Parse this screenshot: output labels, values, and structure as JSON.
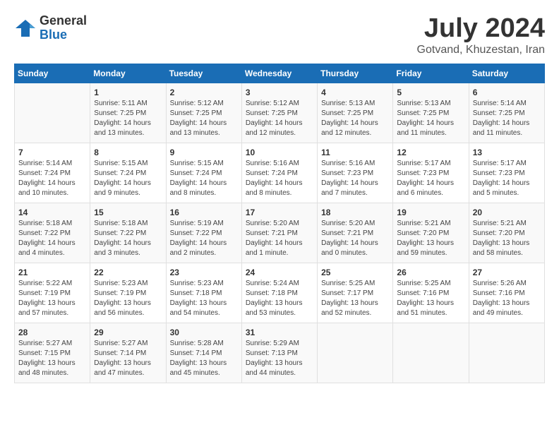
{
  "logo": {
    "text_general": "General",
    "text_blue": "Blue"
  },
  "title": "July 2024",
  "subtitle": "Gotvand, Khuzestan, Iran",
  "days_of_week": [
    "Sunday",
    "Monday",
    "Tuesday",
    "Wednesday",
    "Thursday",
    "Friday",
    "Saturday"
  ],
  "weeks": [
    [
      {
        "day": "",
        "info": ""
      },
      {
        "day": "1",
        "info": "Sunrise: 5:11 AM\nSunset: 7:25 PM\nDaylight: 14 hours\nand 13 minutes."
      },
      {
        "day": "2",
        "info": "Sunrise: 5:12 AM\nSunset: 7:25 PM\nDaylight: 14 hours\nand 13 minutes."
      },
      {
        "day": "3",
        "info": "Sunrise: 5:12 AM\nSunset: 7:25 PM\nDaylight: 14 hours\nand 12 minutes."
      },
      {
        "day": "4",
        "info": "Sunrise: 5:13 AM\nSunset: 7:25 PM\nDaylight: 14 hours\nand 12 minutes."
      },
      {
        "day": "5",
        "info": "Sunrise: 5:13 AM\nSunset: 7:25 PM\nDaylight: 14 hours\nand 11 minutes."
      },
      {
        "day": "6",
        "info": "Sunrise: 5:14 AM\nSunset: 7:25 PM\nDaylight: 14 hours\nand 11 minutes."
      }
    ],
    [
      {
        "day": "7",
        "info": "Sunrise: 5:14 AM\nSunset: 7:24 PM\nDaylight: 14 hours\nand 10 minutes."
      },
      {
        "day": "8",
        "info": "Sunrise: 5:15 AM\nSunset: 7:24 PM\nDaylight: 14 hours\nand 9 minutes."
      },
      {
        "day": "9",
        "info": "Sunrise: 5:15 AM\nSunset: 7:24 PM\nDaylight: 14 hours\nand 8 minutes."
      },
      {
        "day": "10",
        "info": "Sunrise: 5:16 AM\nSunset: 7:24 PM\nDaylight: 14 hours\nand 8 minutes."
      },
      {
        "day": "11",
        "info": "Sunrise: 5:16 AM\nSunset: 7:23 PM\nDaylight: 14 hours\nand 7 minutes."
      },
      {
        "day": "12",
        "info": "Sunrise: 5:17 AM\nSunset: 7:23 PM\nDaylight: 14 hours\nand 6 minutes."
      },
      {
        "day": "13",
        "info": "Sunrise: 5:17 AM\nSunset: 7:23 PM\nDaylight: 14 hours\nand 5 minutes."
      }
    ],
    [
      {
        "day": "14",
        "info": "Sunrise: 5:18 AM\nSunset: 7:22 PM\nDaylight: 14 hours\nand 4 minutes."
      },
      {
        "day": "15",
        "info": "Sunrise: 5:18 AM\nSunset: 7:22 PM\nDaylight: 14 hours\nand 3 minutes."
      },
      {
        "day": "16",
        "info": "Sunrise: 5:19 AM\nSunset: 7:22 PM\nDaylight: 14 hours\nand 2 minutes."
      },
      {
        "day": "17",
        "info": "Sunrise: 5:20 AM\nSunset: 7:21 PM\nDaylight: 14 hours\nand 1 minute."
      },
      {
        "day": "18",
        "info": "Sunrise: 5:20 AM\nSunset: 7:21 PM\nDaylight: 14 hours\nand 0 minutes."
      },
      {
        "day": "19",
        "info": "Sunrise: 5:21 AM\nSunset: 7:20 PM\nDaylight: 13 hours\nand 59 minutes."
      },
      {
        "day": "20",
        "info": "Sunrise: 5:21 AM\nSunset: 7:20 PM\nDaylight: 13 hours\nand 58 minutes."
      }
    ],
    [
      {
        "day": "21",
        "info": "Sunrise: 5:22 AM\nSunset: 7:19 PM\nDaylight: 13 hours\nand 57 minutes."
      },
      {
        "day": "22",
        "info": "Sunrise: 5:23 AM\nSunset: 7:19 PM\nDaylight: 13 hours\nand 56 minutes."
      },
      {
        "day": "23",
        "info": "Sunrise: 5:23 AM\nSunset: 7:18 PM\nDaylight: 13 hours\nand 54 minutes."
      },
      {
        "day": "24",
        "info": "Sunrise: 5:24 AM\nSunset: 7:18 PM\nDaylight: 13 hours\nand 53 minutes."
      },
      {
        "day": "25",
        "info": "Sunrise: 5:25 AM\nSunset: 7:17 PM\nDaylight: 13 hours\nand 52 minutes."
      },
      {
        "day": "26",
        "info": "Sunrise: 5:25 AM\nSunset: 7:16 PM\nDaylight: 13 hours\nand 51 minutes."
      },
      {
        "day": "27",
        "info": "Sunrise: 5:26 AM\nSunset: 7:16 PM\nDaylight: 13 hours\nand 49 minutes."
      }
    ],
    [
      {
        "day": "28",
        "info": "Sunrise: 5:27 AM\nSunset: 7:15 PM\nDaylight: 13 hours\nand 48 minutes."
      },
      {
        "day": "29",
        "info": "Sunrise: 5:27 AM\nSunset: 7:14 PM\nDaylight: 13 hours\nand 47 minutes."
      },
      {
        "day": "30",
        "info": "Sunrise: 5:28 AM\nSunset: 7:14 PM\nDaylight: 13 hours\nand 45 minutes."
      },
      {
        "day": "31",
        "info": "Sunrise: 5:29 AM\nSunset: 7:13 PM\nDaylight: 13 hours\nand 44 minutes."
      },
      {
        "day": "",
        "info": ""
      },
      {
        "day": "",
        "info": ""
      },
      {
        "day": "",
        "info": ""
      }
    ]
  ]
}
